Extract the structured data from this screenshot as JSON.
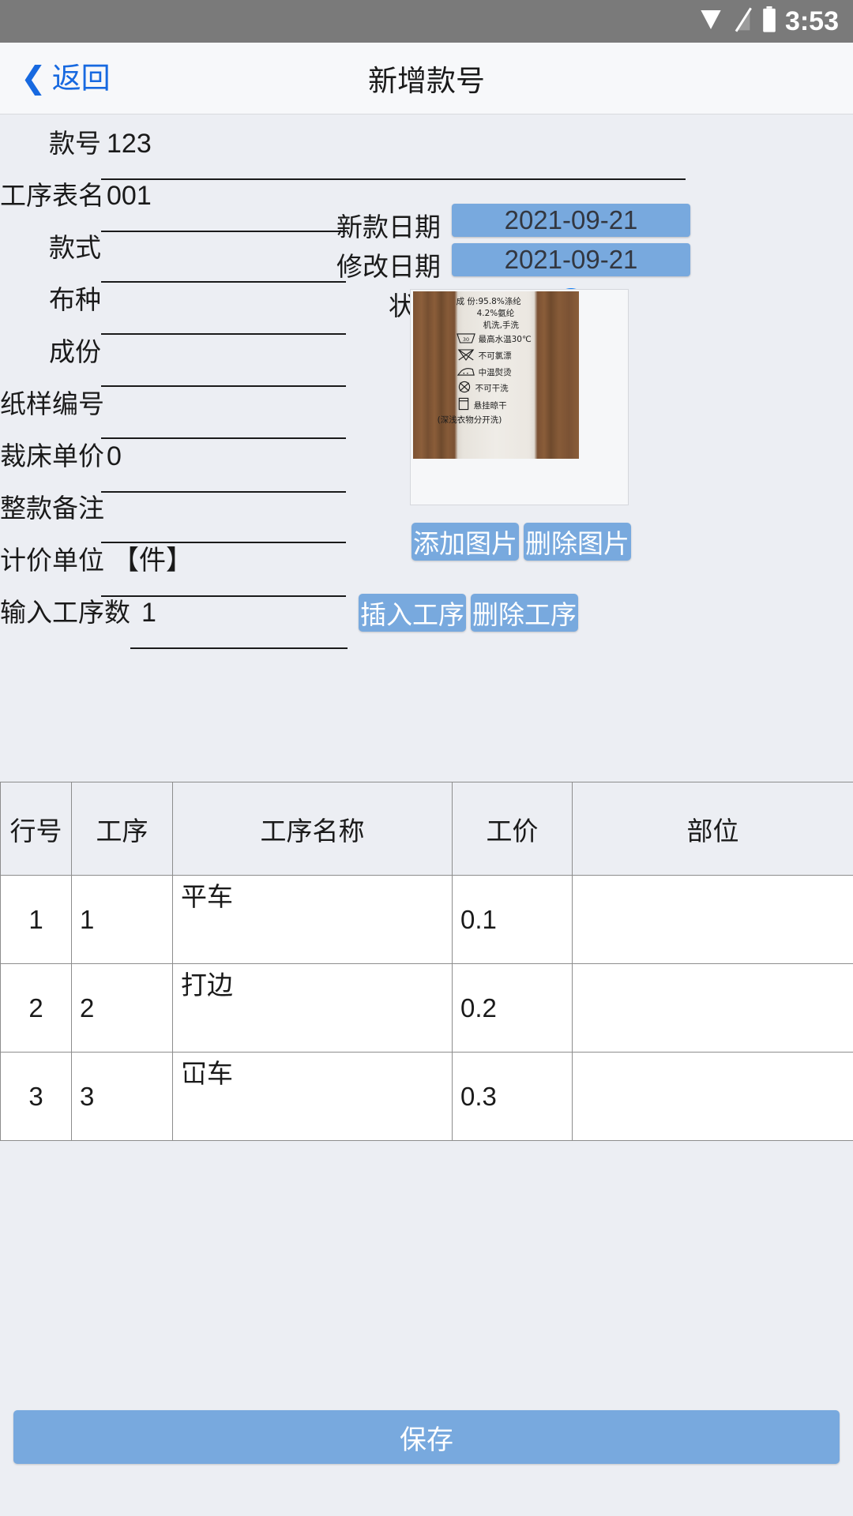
{
  "statusbar": {
    "time": "3:53",
    "icons": [
      "wifi-icon",
      "signal-icon",
      "battery-icon"
    ]
  },
  "titlebar": {
    "back_label": "返回",
    "back_icon": "chevron-left-icon",
    "title": "新增款号"
  },
  "colors": {
    "accent_blue": "#78a9de",
    "link_blue": "#1769e0",
    "check_blue": "#0b7bf5",
    "page_bg": "#eceef3",
    "statusbar_bg": "#7a7a7a"
  },
  "form": {
    "fields": [
      {
        "label": "款号",
        "value": "123"
      },
      {
        "label": "工序表名",
        "value": "001"
      },
      {
        "label": "款式",
        "value": ""
      },
      {
        "label": "布种",
        "value": ""
      },
      {
        "label": "成份",
        "value": ""
      },
      {
        "label": "纸样编号",
        "value": ""
      },
      {
        "label": "裁床单价",
        "value": "0"
      },
      {
        "label": "整款备注",
        "value": ""
      },
      {
        "label": "计价单位",
        "value": "【件】"
      },
      {
        "label": "输入工序数",
        "value": "1"
      }
    ]
  },
  "right_panel": {
    "new_date": {
      "label": "新款日期",
      "value": "2021-09-21"
    },
    "mod_date": {
      "label": "修改日期",
      "value": "2021-09-21"
    },
    "status": {
      "label": "状态",
      "icon": "check-circle-icon",
      "checked": true
    },
    "photo": {
      "name": "garment-care-label-photo",
      "lines": [
        "成 份:95.8%涤纶",
        "4.2%氨纶",
        "机洗,手洗",
        "最高水温30℃",
        "不可氯漂",
        "中温熨烫",
        "不可干洗",
        "悬挂晾干",
        "(深浅衣物分开洗)"
      ],
      "wash_temp": "30"
    },
    "add_photo_label": "添加图片",
    "del_photo_label": "删除图片"
  },
  "process_actions": {
    "insert_label": "插入工序",
    "delete_label": "删除工序"
  },
  "table": {
    "headers": [
      "行号",
      "工序",
      "工序名称",
      "工价",
      "部位"
    ],
    "rows": [
      {
        "idx": "1",
        "seq": "1",
        "name": "平车",
        "price": "0.1",
        "part": ""
      },
      {
        "idx": "2",
        "seq": "2",
        "name": "打边",
        "price": "0.2",
        "part": ""
      },
      {
        "idx": "3",
        "seq": "3",
        "name": "冚车",
        "price": "0.3",
        "part": ""
      }
    ]
  },
  "footer": {
    "save_label": "保存"
  }
}
